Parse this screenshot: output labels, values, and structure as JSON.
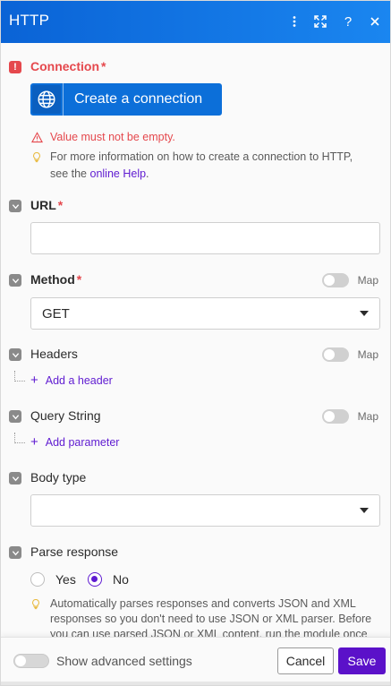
{
  "header": {
    "title": "HTTP",
    "icons": [
      "more-vertical-icon",
      "expand-icon",
      "help-icon",
      "close-icon"
    ]
  },
  "connection": {
    "label": "Connection",
    "required": "*",
    "button_label": "Create a connection",
    "error": "Value must not be empty.",
    "hint_prefix": "For more information on how to create a connection to HTTP, see the",
    "hint_link": "online Help",
    "hint_suffix": "."
  },
  "url": {
    "label": "URL",
    "required": "*",
    "value": ""
  },
  "method": {
    "label": "Method",
    "required": "*",
    "value": "GET",
    "map_label": "Map"
  },
  "headers": {
    "label": "Headers",
    "map_label": "Map",
    "add_label": "Add a header"
  },
  "query_string": {
    "label": "Query String",
    "map_label": "Map",
    "add_label": "Add parameter"
  },
  "body_type": {
    "label": "Body type",
    "value": ""
  },
  "parse_response": {
    "label": "Parse response",
    "options": [
      "Yes",
      "No"
    ],
    "selected": "No",
    "description": "Automatically parses responses and converts JSON and XML responses so you don't need to use JSON or XML parser. Before you can use parsed JSON or XML content, run the module once"
  },
  "footer": {
    "advanced_label": "Show advanced settings",
    "cancel_label": "Cancel",
    "save_label": "Save"
  },
  "colors": {
    "header_blue": "#0a63d6",
    "accent_purple": "#5b11c9",
    "error_red": "#e5484d",
    "link_purple": "#5f1bd1"
  }
}
